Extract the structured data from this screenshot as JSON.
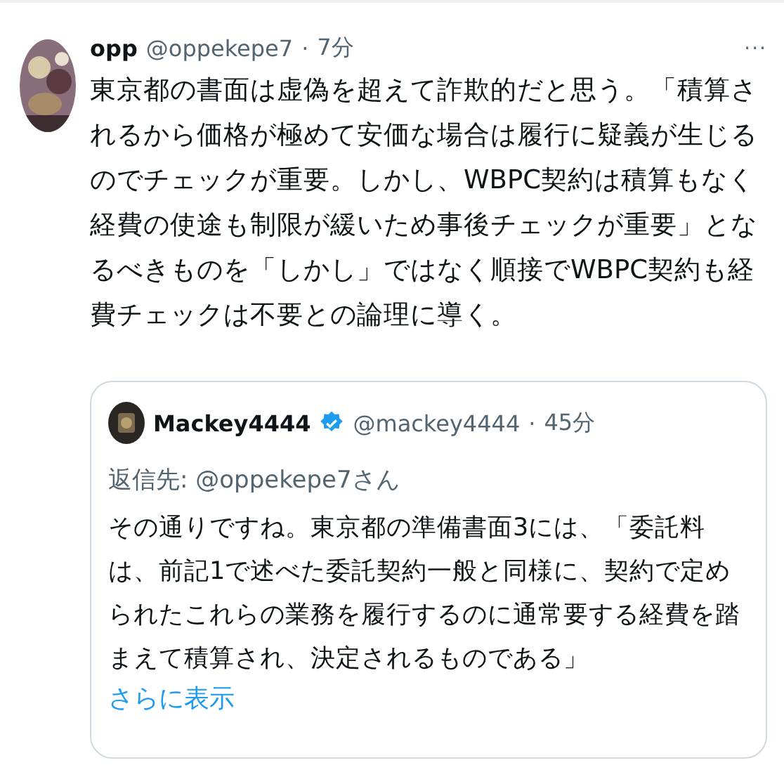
{
  "post": {
    "name": "opp",
    "handle": "@oppekepe7",
    "separator": "·",
    "time": "7分",
    "more": "···",
    "text": "東京都の書面は虚偽を超えて詐欺的だと思う。「積算されるから価格が極めて安価な場合は履行に疑義が生じるのでチェックが重要。しかし、WBPC契約は積算もなく経費の使途も制限が緩いため事後チェックが重要」となるべきものを「しかし」ではなく順接でWBPC契約も経費チェックは不要との論理に導く。"
  },
  "quoted": {
    "name": "Mackey4444",
    "verified": true,
    "handle": "@mackey4444",
    "separator": "·",
    "time": "45分",
    "reply_to": "返信先: @oppekepe7さん",
    "text": "その通りですね。東京都の準備書面3には、「委託料は、前記1で述べた委託契約一般と同様に、契約で定められたこれらの業務を履行するのに通常要する経費を踏まえて積算され、決定されるものである」",
    "show_more": "さらに表示"
  }
}
